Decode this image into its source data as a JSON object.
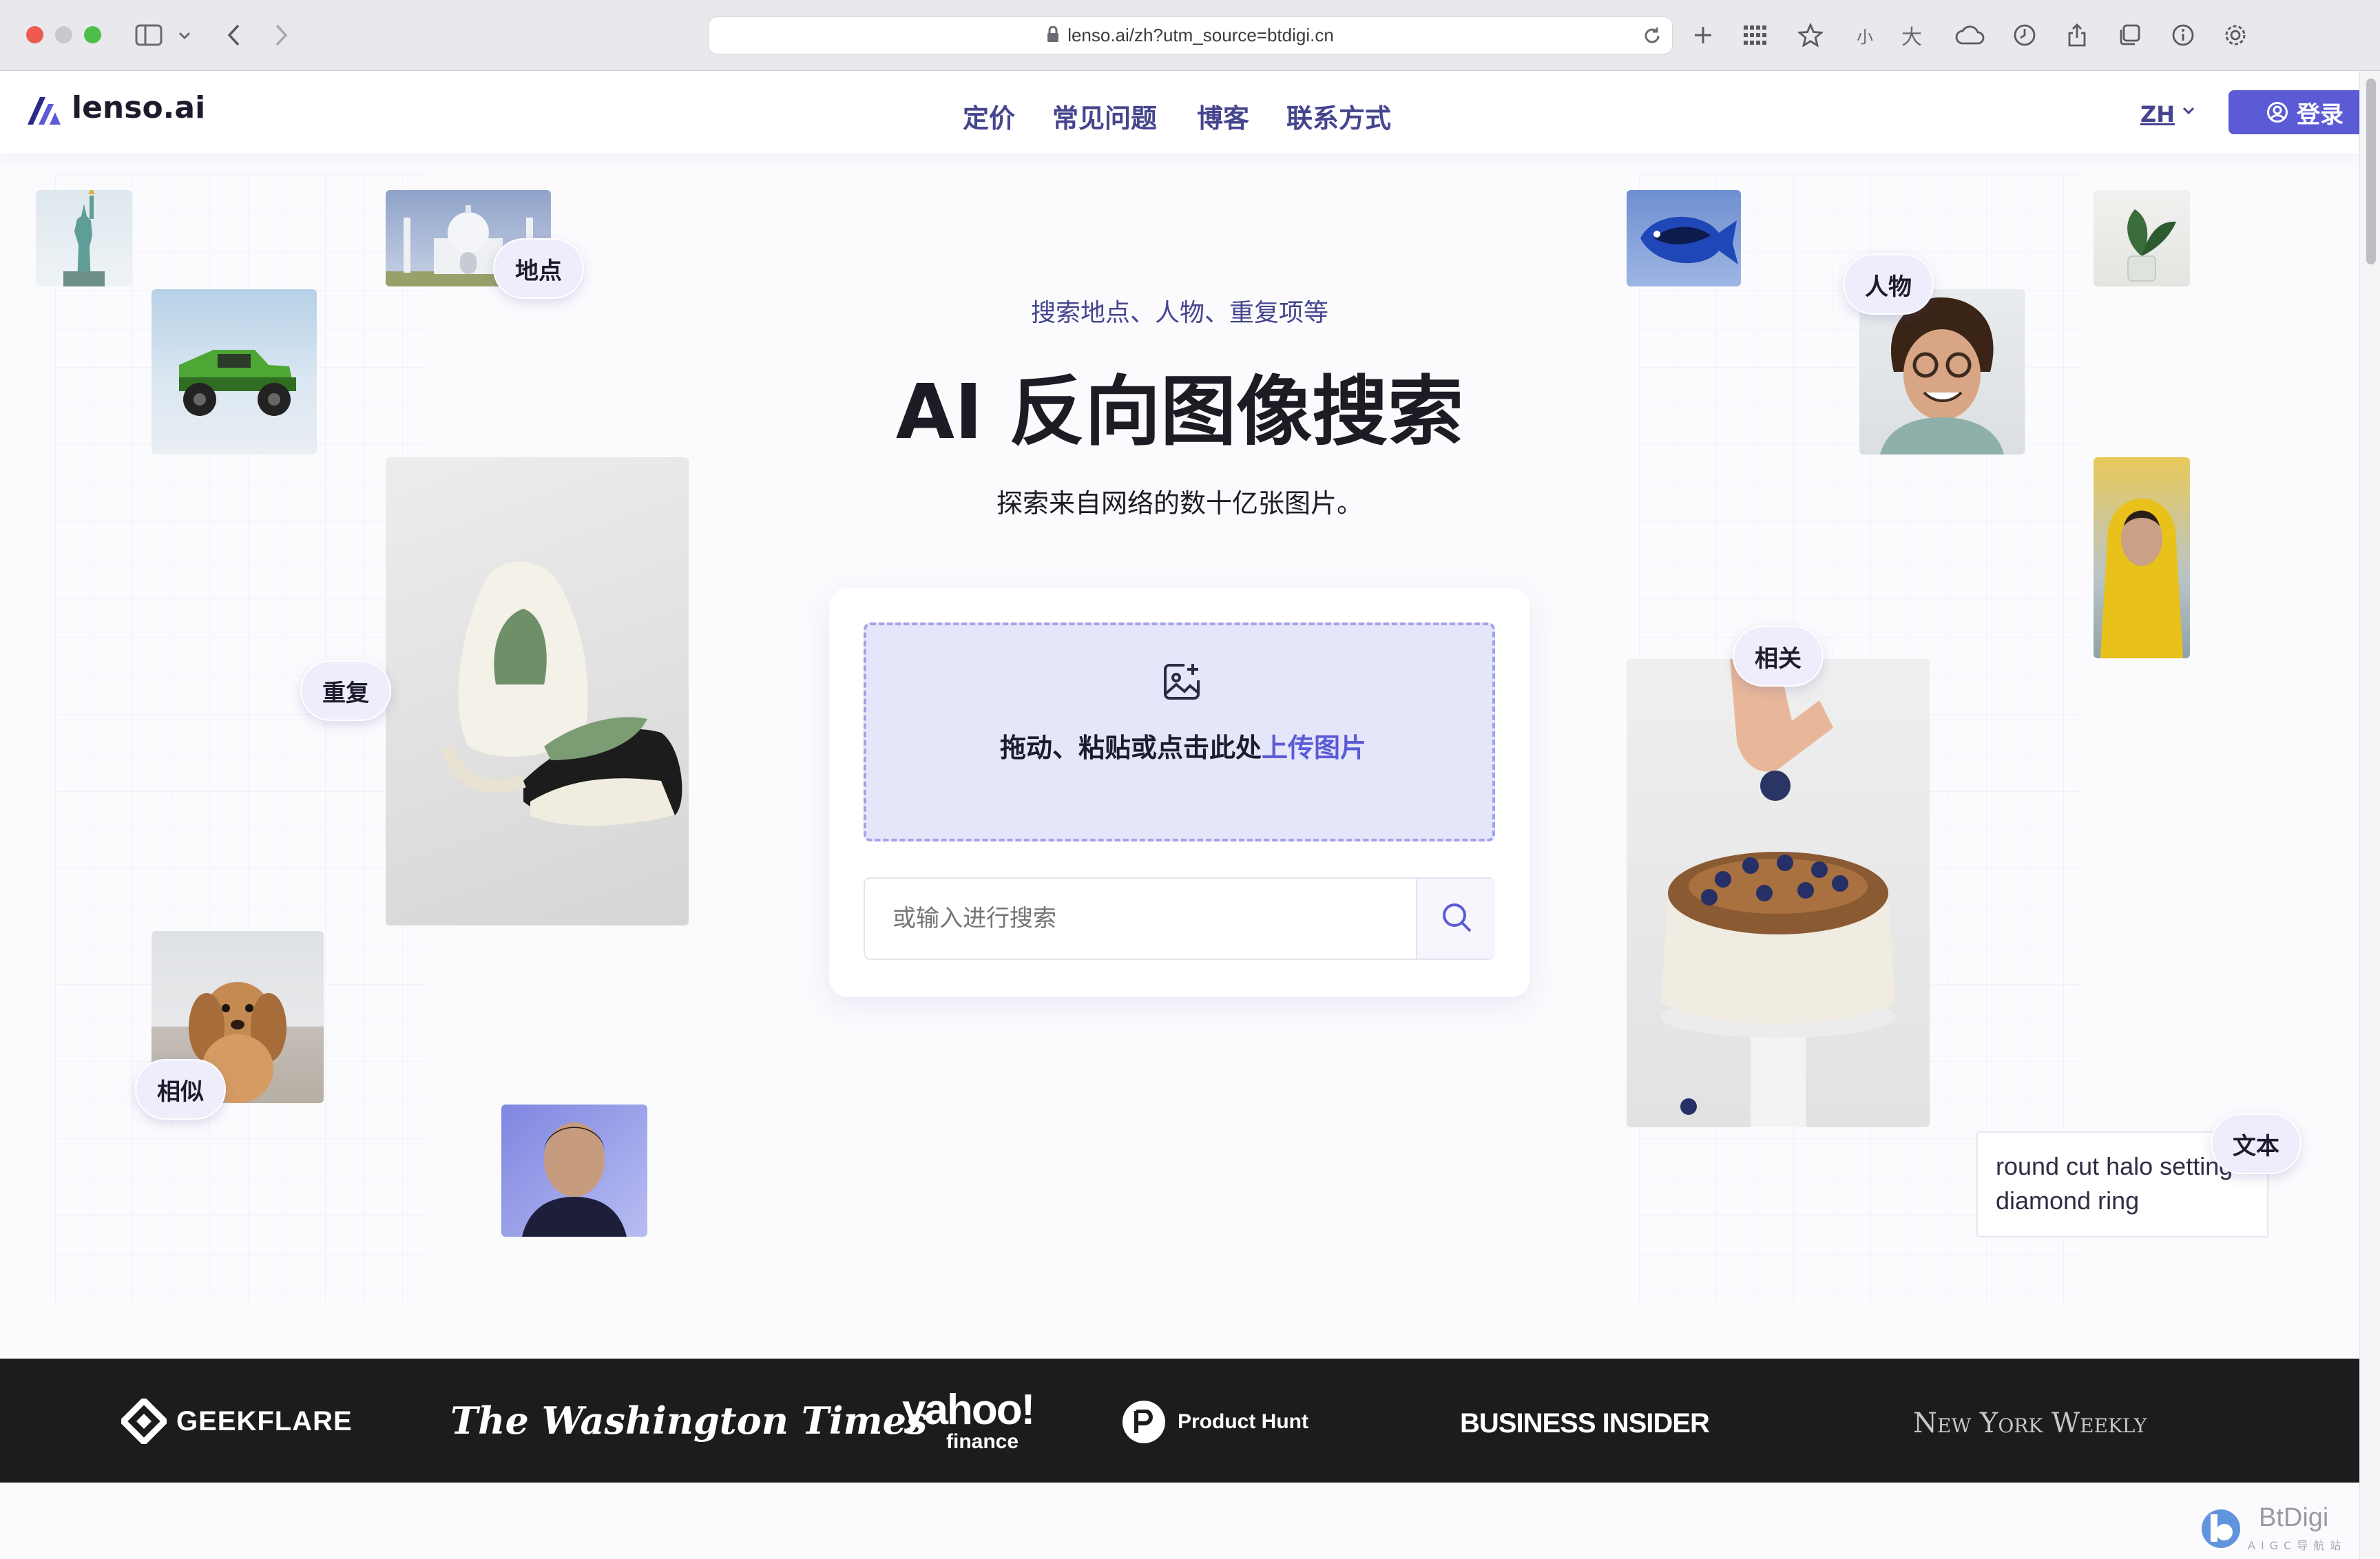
{
  "browser": {
    "url": "lenso.ai/zh?utm_source=btdigi.cn",
    "reader_small": "小",
    "reader_large": "大"
  },
  "nav": {
    "logo_text": "lenso.ai",
    "links": [
      "定价",
      "常见问题",
      "博客",
      "联系方式"
    ],
    "language": "ZH",
    "login": "登录"
  },
  "hero": {
    "subtitle": "搜索地点、人物、重复项等",
    "title": "AI 反向图像搜索",
    "description": "探索来自网络的数十亿张图片。"
  },
  "upload": {
    "text": "拖动、粘贴或点击此处",
    "link": "上传图片"
  },
  "search": {
    "placeholder": "或输入进行搜索"
  },
  "tags": {
    "places": "地点",
    "people": "人物",
    "duplicates": "重复",
    "related": "相关",
    "similar": "相似",
    "text": "文本"
  },
  "text_sample": "round cut halo setting diamond ring",
  "press": {
    "geekflare": "GEEKFLARE",
    "washington": "The Washington Times",
    "yahoo": "yahoo!",
    "yahoo_sub": "finance",
    "producthunt": "Product Hunt",
    "business_insider": "BUSINESS INSIDER",
    "nyweekly": "New York Weekly"
  },
  "watermark": {
    "brand": "BtDigi",
    "sub": "AIGC导航站"
  },
  "colors": {
    "accent": "#5b5bd6",
    "nav_text": "#45458f",
    "drop_bg": "#e6e6fb",
    "footer_bg": "#1c1c1f"
  }
}
